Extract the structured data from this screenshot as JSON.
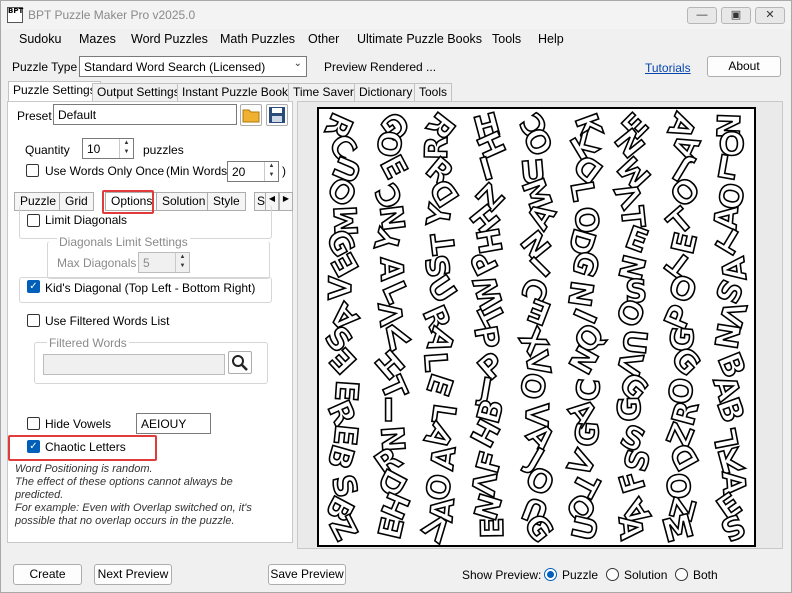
{
  "window": {
    "title": "BPT Puzzle Maker Pro v2025.0"
  },
  "menu": [
    "Sudoku",
    "Mazes",
    "Word Puzzles",
    "Math Puzzles",
    "Other",
    "Ultimate Puzzle Books",
    "Tools",
    "Help"
  ],
  "toolbar": {
    "puzzle_type_label": "Puzzle Type",
    "puzzle_type_value": "Standard Word Search (Licensed)",
    "status": "Preview Rendered ...",
    "tutorials_link": "Tutorials",
    "about_label": "About"
  },
  "tabs": [
    "Puzzle Settings",
    "Output Settings",
    "Instant Puzzle Books",
    "Time Saver",
    "Dictionary",
    "Tools"
  ],
  "settings": {
    "preset_label": "Preset",
    "preset_value": "Default",
    "quantity_label": "Quantity",
    "quantity_value": "10",
    "puzzles_label": "puzzles",
    "use_words_once_label": "Use Words Only Once",
    "min_words_label": "(Min Words:",
    "min_words_value": "20",
    "min_words_close": ")"
  },
  "subtabs": [
    "Puzzle",
    "Grid",
    "Options",
    "Solution",
    "Style",
    "S"
  ],
  "options": {
    "limit_diagonals_label": "Limit Diagonals",
    "diagonals_group_title": "Diagonals Limit Settings",
    "max_diagonals_label": "Max Diagonals",
    "max_diagonals_value": "5",
    "kids_diagonal_label": "Kid's Diagonal (Top Left - Bottom Right)",
    "use_filtered_label": "Use Filtered Words List",
    "filtered_words_title": "Filtered Words",
    "hide_vowels_label": "Hide Vowels",
    "hide_vowels_value": "AEIOUY",
    "chaotic_letters_label": "Chaotic Letters",
    "note_lines": [
      "Word Positioning is random.",
      "The effect of these options cannot always be",
      "predicted.",
      "For example: Even with Overlap switched on, it's",
      "possible that no overlap occurs in the puzzle."
    ]
  },
  "footer": {
    "create_label": "Create",
    "next_preview_label": "Next Preview",
    "save_preview_label": "Save Preview",
    "show_preview_label": "Show Preview:",
    "radio_puzzle": "Puzzle",
    "radio_solution": "Solution",
    "radio_both": "Both"
  },
  "puzzle_grid": [
    "RGRHCKEAN",
    "CORHOKNAO",
    "UERIUDMJL",
    "OCDZMLVOO",
    "MNYHAOTTA",
    "GYTHNDEET",
    "EASPIGNTA",
    "VLUWCNSOS",
    "AVRTEIOPV",
    "SVAPXQUGN",
    "EHLPVNVGB",
    "ETEJOCGOA",
    "RILBVAGRB",
    "ENAHAGSZL",
    "BRAFJVSDK",
    "SDOVOTFOA",
    "BHANUOAZE",
    "ZEVEGUAMS"
  ]
}
